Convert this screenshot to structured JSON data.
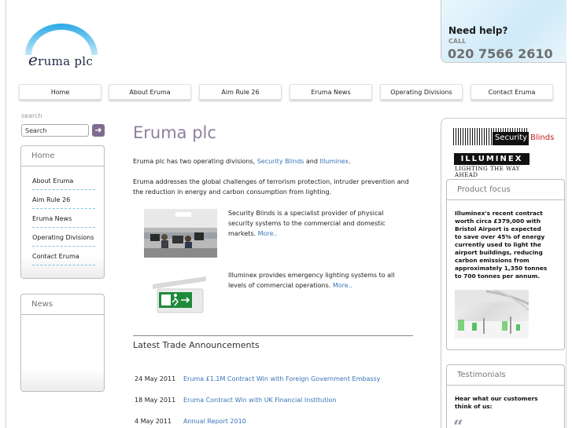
{
  "brand": {
    "logo_text": "ruma plc",
    "logo_initial": "e"
  },
  "help": {
    "title": "Need help?",
    "call_label": "CALL",
    "phone": "020 7566 2610"
  },
  "nav": {
    "items": [
      {
        "label": "Home"
      },
      {
        "label": "About Eruma"
      },
      {
        "label": "Aim Rule 26"
      },
      {
        "label": "Eruma News"
      },
      {
        "label": "Operating Divisions"
      },
      {
        "label": "Contact Eruma"
      }
    ]
  },
  "search": {
    "label": "search",
    "placeholder": "Search"
  },
  "sidebar": {
    "home_title": "Home",
    "items": [
      {
        "label": "About Eruma"
      },
      {
        "label": "Aim Rule 26"
      },
      {
        "label": "Eruma News"
      },
      {
        "label": "Operating Divisions"
      },
      {
        "label": "Contact Eruma"
      }
    ],
    "news_title": "News"
  },
  "main": {
    "title": "Eruma plc",
    "intro_prefix": "Eruma plc  has two operating divisions, ",
    "intro_link1": "Security Blinds",
    "intro_mid": " and ",
    "intro_link2": "Illuminex",
    "intro_suffix": ".",
    "para2": "Eruma addresses the global challenges of terrorism protection, intruder prevention and the reduction in energy and carbon consumption from lighting.",
    "security_desc": "Security Blinds is a specialist provider of physical security systems to the commercial and domestic markets. ",
    "illuminex_desc": "Illuminex provides emergency lighting systems to all levels of commercial  operations. ",
    "more_label": "More..",
    "announcements_title": "Latest Trade Announcements",
    "announcements": [
      {
        "date": "24 May 2011",
        "title": "Eruma £1.1M Contract Win with Foreign Government Embassy"
      },
      {
        "date": "18 May 2011",
        "title": "Eruma Contract  Win with UK Financial Institution"
      },
      {
        "date": "4 May 2011",
        "title": "Annual Report 2010"
      }
    ]
  },
  "right": {
    "security_logo_word1": "Security",
    "security_logo_word2": "Blinds",
    "illuminex_logo": "ILLUMINEX",
    "illuminex_tagline": "LIGHTING THE WAY AHEAD",
    "focus_title": "Product focus",
    "focus_text": "Illuminex's recent contract worth circa £379,000 with Bristol Airport is expected to save over 45% of energy currently used to light the airport buildings, reducing carbon emissions from approximately 1,350 tonnes to 700 tonnes per annum.",
    "testimonials_title": "Testimonials",
    "testimonials_text": "Hear what our customers think of us:",
    "quote_glyph": "“"
  },
  "colors": {
    "accent_purple": "#8e7e9e",
    "link_blue": "#3a74b8",
    "security_red": "#c21e1e"
  }
}
